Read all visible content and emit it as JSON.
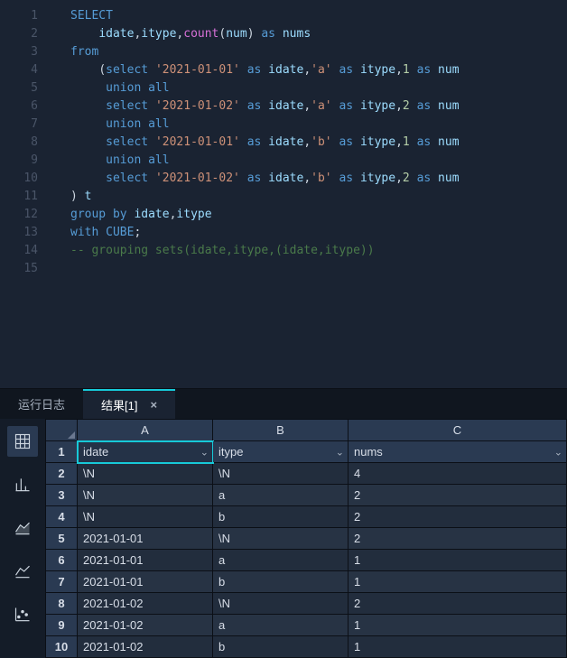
{
  "editor": {
    "lines": [
      {
        "n": "1",
        "tokens": [
          [
            "kw1",
            "SELECT"
          ]
        ]
      },
      {
        "n": "2",
        "tokens": [
          [
            "wht",
            "    "
          ],
          [
            "id",
            "idate"
          ],
          [
            "op",
            ","
          ],
          [
            "id",
            "itype"
          ],
          [
            "op",
            ","
          ],
          [
            "fn",
            "count"
          ],
          [
            "op",
            "("
          ],
          [
            "id",
            "num"
          ],
          [
            "op",
            ")"
          ],
          [
            "wht",
            " "
          ],
          [
            "kw",
            "as"
          ],
          [
            "wht",
            " "
          ],
          [
            "id",
            "nums"
          ]
        ]
      },
      {
        "n": "3",
        "tokens": [
          [
            "kw",
            "from"
          ]
        ]
      },
      {
        "n": "4",
        "tokens": [
          [
            "wht",
            "    "
          ],
          [
            "op",
            "("
          ],
          [
            "kw",
            "select"
          ],
          [
            "wht",
            " "
          ],
          [
            "str",
            "'2021-01-01'"
          ],
          [
            "wht",
            " "
          ],
          [
            "kw",
            "as"
          ],
          [
            "wht",
            " "
          ],
          [
            "id",
            "idate"
          ],
          [
            "op",
            ","
          ],
          [
            "str",
            "'a'"
          ],
          [
            "wht",
            " "
          ],
          [
            "kw",
            "as"
          ],
          [
            "wht",
            " "
          ],
          [
            "id",
            "itype"
          ],
          [
            "op",
            ","
          ],
          [
            "num",
            "1"
          ],
          [
            "wht",
            " "
          ],
          [
            "kw",
            "as"
          ],
          [
            "wht",
            " "
          ],
          [
            "id",
            "num"
          ]
        ]
      },
      {
        "n": "5",
        "tokens": [
          [
            "wht",
            "     "
          ],
          [
            "kw",
            "union"
          ],
          [
            "wht",
            " "
          ],
          [
            "kw",
            "all"
          ]
        ]
      },
      {
        "n": "6",
        "tokens": [
          [
            "wht",
            "     "
          ],
          [
            "kw",
            "select"
          ],
          [
            "wht",
            " "
          ],
          [
            "str",
            "'2021-01-02'"
          ],
          [
            "wht",
            " "
          ],
          [
            "kw",
            "as"
          ],
          [
            "wht",
            " "
          ],
          [
            "id",
            "idate"
          ],
          [
            "op",
            ","
          ],
          [
            "str",
            "'a'"
          ],
          [
            "wht",
            " "
          ],
          [
            "kw",
            "as"
          ],
          [
            "wht",
            " "
          ],
          [
            "id",
            "itype"
          ],
          [
            "op",
            ","
          ],
          [
            "num",
            "2"
          ],
          [
            "wht",
            " "
          ],
          [
            "kw",
            "as"
          ],
          [
            "wht",
            " "
          ],
          [
            "id",
            "num"
          ]
        ]
      },
      {
        "n": "7",
        "tokens": [
          [
            "wht",
            "     "
          ],
          [
            "kw",
            "union"
          ],
          [
            "wht",
            " "
          ],
          [
            "kw",
            "all"
          ]
        ]
      },
      {
        "n": "8",
        "tokens": [
          [
            "wht",
            "     "
          ],
          [
            "kw",
            "select"
          ],
          [
            "wht",
            " "
          ],
          [
            "str",
            "'2021-01-01'"
          ],
          [
            "wht",
            " "
          ],
          [
            "kw",
            "as"
          ],
          [
            "wht",
            " "
          ],
          [
            "id",
            "idate"
          ],
          [
            "op",
            ","
          ],
          [
            "str",
            "'b'"
          ],
          [
            "wht",
            " "
          ],
          [
            "kw",
            "as"
          ],
          [
            "wht",
            " "
          ],
          [
            "id",
            "itype"
          ],
          [
            "op",
            ","
          ],
          [
            "num",
            "1"
          ],
          [
            "wht",
            " "
          ],
          [
            "kw",
            "as"
          ],
          [
            "wht",
            " "
          ],
          [
            "id",
            "num"
          ]
        ]
      },
      {
        "n": "9",
        "tokens": [
          [
            "wht",
            "     "
          ],
          [
            "kw",
            "union"
          ],
          [
            "wht",
            " "
          ],
          [
            "kw",
            "all"
          ]
        ]
      },
      {
        "n": "10",
        "tokens": [
          [
            "wht",
            "     "
          ],
          [
            "kw",
            "select"
          ],
          [
            "wht",
            " "
          ],
          [
            "str",
            "'2021-01-02'"
          ],
          [
            "wht",
            " "
          ],
          [
            "kw",
            "as"
          ],
          [
            "wht",
            " "
          ],
          [
            "id",
            "idate"
          ],
          [
            "op",
            ","
          ],
          [
            "str",
            "'b'"
          ],
          [
            "wht",
            " "
          ],
          [
            "kw",
            "as"
          ],
          [
            "wht",
            " "
          ],
          [
            "id",
            "itype"
          ],
          [
            "op",
            ","
          ],
          [
            "num",
            "2"
          ],
          [
            "wht",
            " "
          ],
          [
            "kw",
            "as"
          ],
          [
            "wht",
            " "
          ],
          [
            "id",
            "num"
          ]
        ]
      },
      {
        "n": "11",
        "tokens": [
          [
            "op",
            ") "
          ],
          [
            "id",
            "t"
          ]
        ]
      },
      {
        "n": "12",
        "tokens": [
          [
            "kw",
            "group"
          ],
          [
            "wht",
            " "
          ],
          [
            "kw",
            "by"
          ],
          [
            "wht",
            " "
          ],
          [
            "id",
            "idate"
          ],
          [
            "op",
            ","
          ],
          [
            "id",
            "itype"
          ]
        ]
      },
      {
        "n": "13",
        "tokens": [
          [
            "kw",
            "with"
          ],
          [
            "wht",
            " "
          ],
          [
            "kw1",
            "CUBE"
          ],
          [
            "op",
            ";"
          ]
        ]
      },
      {
        "n": "14",
        "tokens": [
          [
            "cm",
            "-- grouping sets(idate,itype,(idate,itype))"
          ]
        ]
      },
      {
        "n": "15",
        "tokens": []
      }
    ]
  },
  "tabs": {
    "log": "运行日志",
    "result": "结果[1]",
    "close": "×"
  },
  "grid": {
    "colLabels": {
      "A": "A",
      "B": "B",
      "C": "C"
    },
    "headerRow": {
      "n": "1",
      "A": "idate",
      "B": "itype",
      "C": "nums"
    },
    "rows": [
      {
        "n": "2",
        "A": "\\N",
        "B": "\\N",
        "C": "4"
      },
      {
        "n": "3",
        "A": "\\N",
        "B": "a",
        "C": "2"
      },
      {
        "n": "4",
        "A": "\\N",
        "B": "b",
        "C": "2"
      },
      {
        "n": "5",
        "A": "2021-01-01",
        "B": "\\N",
        "C": "2"
      },
      {
        "n": "6",
        "A": "2021-01-01",
        "B": "a",
        "C": "1"
      },
      {
        "n": "7",
        "A": "2021-01-01",
        "B": "b",
        "C": "1"
      },
      {
        "n": "8",
        "A": "2021-01-02",
        "B": "\\N",
        "C": "2"
      },
      {
        "n": "9",
        "A": "2021-01-02",
        "B": "a",
        "C": "1"
      },
      {
        "n": "10",
        "A": "2021-01-02",
        "B": "b",
        "C": "1"
      }
    ]
  }
}
